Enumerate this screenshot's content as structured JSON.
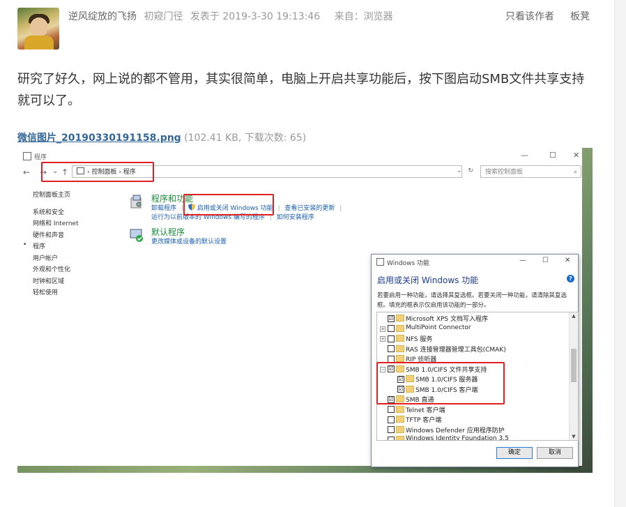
{
  "post": {
    "author": "逆风绽放的飞扬",
    "rank": "初窥门径",
    "posted": "发表于 2019-3-30 19:13:46",
    "source": "来自：浏览器",
    "only_author": "只看该作者",
    "seat": "板凳",
    "content": "研究了好久，网上说的都不管用，其实很简单，电脑上开启共享功能后，按下图启动SMB文件共享支持就可以了。"
  },
  "attachment": {
    "filename": "微信图片_20190330191158.png",
    "info": "(102.41 KB, 下载次数: 65)"
  },
  "control_panel": {
    "window_title": "程序",
    "minimize": "—",
    "maximize": "☐",
    "close": "✕",
    "back": "←",
    "forward": "→",
    "recent": "⌄",
    "up": "↑",
    "breadcrumb": "› 控制面板 › 程序",
    "dropdown": "⌄",
    "refresh": "↻",
    "search_placeholder": "搜索控制面板",
    "search_icon": "⌕",
    "sidebar": {
      "home": "控制面板主页",
      "items": [
        "系统和安全",
        "网络和 Internet",
        "硬件和声音",
        "程序",
        "用户帐户",
        "外观和个性化",
        "时钟和区域",
        "轻松使用"
      ],
      "bullet": "•"
    },
    "programs": {
      "title": "程序和功能",
      "link1": "卸载程序",
      "link2": "启用或关闭 Windows 功能",
      "link3": "查看已安装的更新",
      "link4": "运行为以前版本的 Windows 编写的程序",
      "link5": "如何安装程序",
      "separator": "|"
    },
    "defaults": {
      "title": "默认程序",
      "link1": "更改媒体或设备的默认设置"
    }
  },
  "features_dialog": {
    "title": "Windows 功能",
    "minimize": "—",
    "maximize": "☐",
    "close": "✕",
    "heading": "启用或关闭 Windows 功能",
    "help": "?",
    "description": "若要启用一种功能，请选择其复选框。若要关闭一种功能，请清除其复选框。填充的框表示仅启用该功能的一部分。",
    "items": [
      {
        "label": "Microsoft XPS 文档写入程序",
        "checked": "☑",
        "expander": "",
        "indent": 0
      },
      {
        "label": "MultiPoint Connector",
        "checked": "",
        "expander": "+",
        "indent": 0
      },
      {
        "label": "NFS 服务",
        "checked": "",
        "expander": "+",
        "indent": 0
      },
      {
        "label": "RAS 连接管理器管理工具包(CMAK)",
        "checked": "",
        "expander": "",
        "indent": 0
      },
      {
        "label": "RIP 侦听器",
        "checked": "",
        "expander": "",
        "indent": 0
      },
      {
        "label": "SMB 1.0/CIFS 文件共享支持",
        "checked": "☑",
        "expander": "−",
        "indent": 0
      },
      {
        "label": "SMB 1.0/CIFS 服务器",
        "checked": "☑",
        "expander": "",
        "indent": 1
      },
      {
        "label": "SMB 1.0/CIFS 客户端",
        "checked": "☑",
        "expander": "",
        "indent": 1
      },
      {
        "label": "SMB 直通",
        "checked": "☑",
        "expander": "",
        "indent": 0
      },
      {
        "label": "Telnet 客户端",
        "checked": "",
        "expander": "",
        "indent": 0
      },
      {
        "label": "TFTP 客户端",
        "checked": "",
        "expander": "",
        "indent": 0
      },
      {
        "label": "Windows Defender 应用程序防护",
        "checked": "",
        "expander": "",
        "indent": 0
      },
      {
        "label": "Windows Identity Foundation 3.5",
        "checked": "",
        "expander": "",
        "indent": 0
      }
    ],
    "scroll_up": "▲",
    "scroll_down": "▼",
    "ok": "确定",
    "cancel": "取消"
  },
  "colors": {
    "link": "#336699",
    "highlight_box": "#e02020",
    "cp_category_title": "#1a8a3a",
    "cp_link": "#1a5fb4"
  }
}
